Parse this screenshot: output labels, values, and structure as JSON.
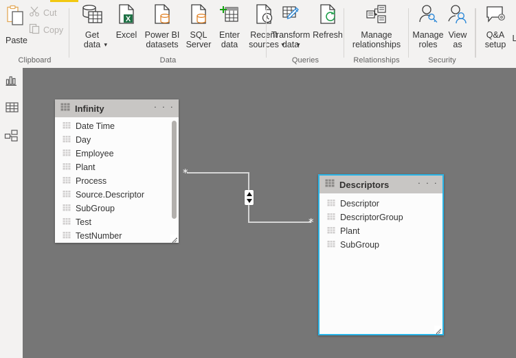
{
  "ribbon": {
    "active_tab_indicator_color": "#f2c811",
    "groups": [
      {
        "name": "Clipboard",
        "caption": "Clipboard",
        "buttons": [
          {
            "label": "Paste",
            "icon": "paste-icon",
            "disabled": false
          },
          {
            "label": "Cut",
            "icon": "scissors-icon",
            "disabled": true
          },
          {
            "label": "Copy",
            "icon": "copy-icon",
            "disabled": true
          }
        ]
      },
      {
        "name": "Data",
        "caption": "Data",
        "buttons": [
          {
            "label": "Get\ndata",
            "icon": "get-data-icon",
            "caret": true
          },
          {
            "label": "Excel",
            "icon": "excel-icon",
            "caret": false
          },
          {
            "label": "Power BI\ndatasets",
            "icon": "powerbi-datasets-icon",
            "caret": false
          },
          {
            "label": "SQL\nServer",
            "icon": "sql-server-icon",
            "caret": false
          },
          {
            "label": "Enter\ndata",
            "icon": "enter-data-icon",
            "caret": false
          },
          {
            "label": "Recent\nsources",
            "icon": "recent-sources-icon",
            "caret": true
          }
        ]
      },
      {
        "name": "Queries",
        "caption": "Queries",
        "buttons": [
          {
            "label": "Transform\ndata",
            "icon": "transform-data-icon",
            "caret": true
          },
          {
            "label": "Refresh",
            "icon": "refresh-icon",
            "caret": false
          }
        ]
      },
      {
        "name": "Relationships",
        "caption": "Relationships",
        "buttons": [
          {
            "label": "Manage\nrelationships",
            "icon": "manage-relationships-icon",
            "caret": false
          }
        ]
      },
      {
        "name": "Security",
        "caption": "Security",
        "buttons": [
          {
            "label": "Manage\nroles",
            "icon": "manage-roles-icon",
            "caret": false
          },
          {
            "label": "View\nas",
            "icon": "view-as-icon",
            "caret": false
          }
        ]
      },
      {
        "name": "QA",
        "caption": "",
        "buttons": [
          {
            "label": "Q&A\nsetup",
            "icon": "qa-setup-icon",
            "caret": false
          },
          {
            "label": "L",
            "icon": "clipped-icon",
            "caret": false
          }
        ]
      }
    ]
  },
  "leftnav": {
    "items": [
      {
        "name": "report-view",
        "icon": "bar-chart-icon"
      },
      {
        "name": "data-view",
        "icon": "table-grid-icon"
      },
      {
        "name": "model-view",
        "icon": "model-relationship-icon"
      }
    ]
  },
  "canvas": {
    "background_color": "#767676",
    "tables": [
      {
        "name": "Infinity",
        "title": "Infinity",
        "selected": false,
        "overflow_menu": "· · ·",
        "fields": [
          "Date Time",
          "Day",
          "Employee",
          "Plant",
          "Process",
          "Source.Descriptor",
          "SubGroup",
          "Test",
          "TestNumber"
        ]
      },
      {
        "name": "Descriptors",
        "title": "Descriptors",
        "selected": true,
        "selection_color": "#29b5e8",
        "overflow_menu": "· · ·",
        "fields": [
          "Descriptor",
          "DescriptorGroup",
          "Plant",
          "SubGroup"
        ]
      }
    ],
    "relationship": {
      "from_table": "Infinity",
      "to_table": "Descriptors",
      "from_cardinality": "*",
      "to_cardinality": "*",
      "cross_filter_direction": "both",
      "line_color": "#d6d6d6"
    }
  }
}
